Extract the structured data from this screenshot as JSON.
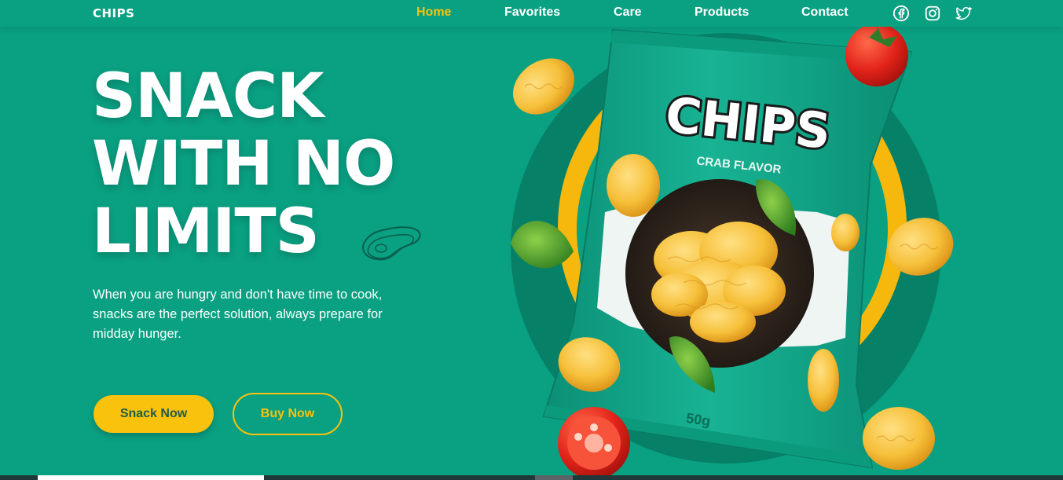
{
  "header": {
    "logo": "CHIPS",
    "nav": [
      "Home",
      "Favorites",
      "Care",
      "Products",
      "Contact"
    ],
    "active": "Home",
    "social": [
      "facebook-icon",
      "instagram-icon",
      "twitter-icon"
    ]
  },
  "hero": {
    "title_lines": [
      "SNACK",
      "WITH NO",
      "LIMITS"
    ],
    "description": "When you are hungry and don't have time to cook, snacks are the perfect solution, always prepare for midday hunger.",
    "primary_button": "Snack Now",
    "secondary_button": "Buy Now"
  },
  "product": {
    "brand": "CHIPS",
    "flavor": "CRAB FLAVOR",
    "weight": "50g"
  },
  "colors": {
    "background": "#0aa082",
    "accent": "#f9c20c",
    "dark_circle": "#078068"
  }
}
